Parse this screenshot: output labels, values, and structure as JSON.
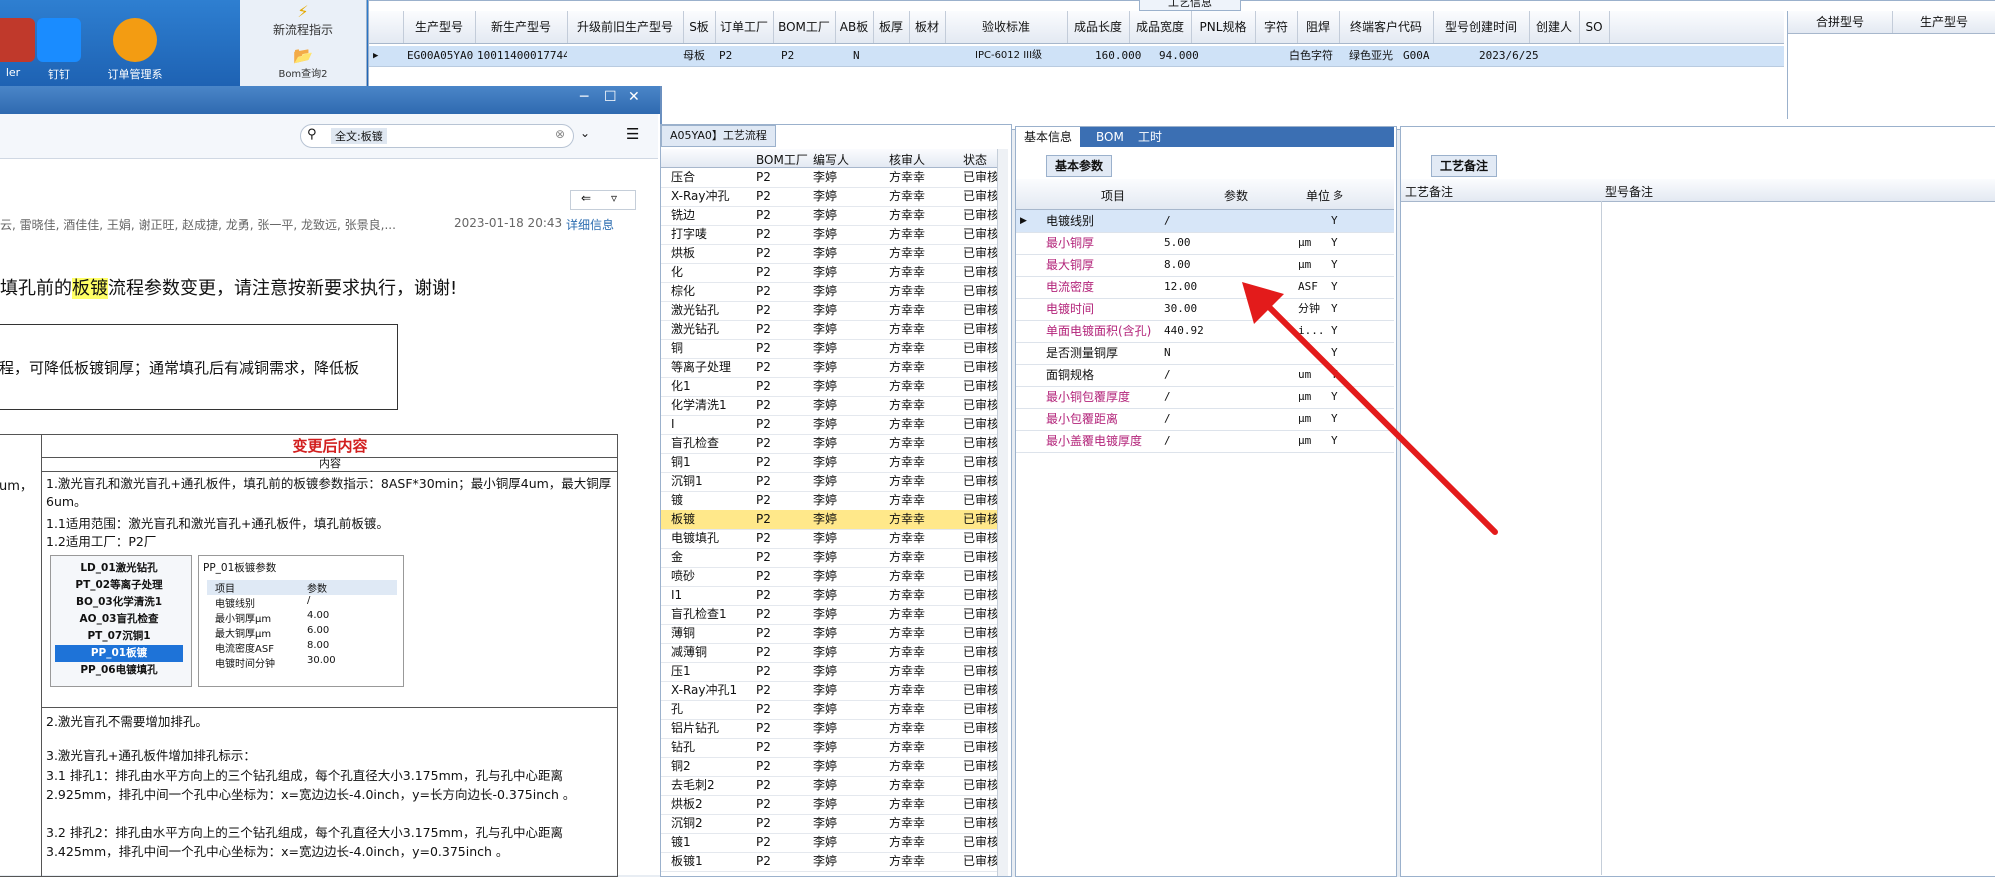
{
  "desktop": {
    "icons": [
      {
        "label": "ler",
        "color": "#c0392b"
      },
      {
        "label": "钉钉",
        "color": "#1a8cff"
      },
      {
        "label": "订单管理系",
        "color": "#f39c12"
      }
    ],
    "left_panel": {
      "item1": "新流程指示",
      "item2": "Bom查询2"
    }
  },
  "top_grid": {
    "headers": [
      "生产型号",
      "新生产型号",
      "升级前旧生产型号",
      "S板",
      "订单工厂",
      "BOM工厂",
      "AB板",
      "板厚",
      "板材",
      "验收标准",
      "成品长度",
      "成品宽度",
      "PNL规格",
      "字符",
      "阻焊",
      "终端客户代码",
      "型号创建时间",
      "创建人",
      "SO"
    ],
    "row": [
      "EG00A05YA0",
      "10011400017744",
      "",
      "母板",
      "P2",
      "P2",
      "N",
      "",
      "",
      "IPC-6012 III级",
      "160.000",
      "94.000",
      "",
      "白色字符",
      "绿色亚光",
      "G00A",
      "2023/6/25",
      "",
      ""
    ],
    "side_headers": [
      "合拼型号",
      "生产型号"
    ],
    "banner": "工艺信息"
  },
  "mail": {
    "search_text": "全文:板镀",
    "recipients": "云, 雷晓佳, 酒佳佳, 王娟, 谢正旺, 赵成捷, 龙勇, 张一平, 龙致远, 张景良,...",
    "date": "2023-01-18 20:43",
    "detail_link": "详细信息",
    "headline_before": "填孔前的",
    "headline_highlight": "板镀",
    "headline_after": "流程参数变更，请注意按新要求执行，谢谢!",
    "box_text": "程，可降低板镀铜厚；通常填孔后有减铜需求，降低板",
    "change_header": "变更后内容",
    "content_label": "内容",
    "left_fragment": "um，",
    "para1": "1.激光盲孔和激光盲孔+通孔板件，填孔前的板镀参数指示：8ASF*30min；最小铜厚4um，最大铜厚6um。",
    "para1_1": "1.1适用范围：激光盲孔和激光盲孔+通孔板件，填孔前板镀。",
    "para1_2": "1.2适用工厂：P2厂",
    "mini_list": [
      "LD_01激光钻孔",
      "PT_02等离子处理",
      "BO_03化学清洗1",
      "AO_03盲孔检查",
      "PT_07沉铜1",
      "PP_01板镀",
      "PP_06电镀填孔"
    ],
    "mini_title": "PP_01板镀参数",
    "mini_headers": [
      "项目",
      "参数"
    ],
    "mini_rows": [
      [
        "电镀线别",
        "/"
      ],
      [
        "最小铜厚μm",
        "4.00"
      ],
      [
        "最大铜厚μm",
        "6.00"
      ],
      [
        "电流密度ASF",
        "8.00"
      ],
      [
        "电镀时间分钟",
        "30.00"
      ]
    ],
    "para2": "2.激光盲孔不需要增加排孔。",
    "para3": "3.激光盲孔+通孔板件增加排孔标示：",
    "para3_1a": "3.1 排孔1：排孔由水平方向上的三个钻孔组成，每个孔直径大小3.175mm，孔与孔中心距离",
    "para3_1b": "2.925mm，排孔中间一个孔中心坐标为：x=宽边边长-4.0inch，y=长方向边长-0.375inch 。",
    "para3_2a": "3.2 排孔2：排孔由水平方向上的三个钻孔组成，每个孔直径大小3.175mm，孔与孔中心距离",
    "para3_2b": "3.425mm，排孔中间一个孔中心坐标为：x=宽边边长-4.0inch，y=0.375inch 。"
  },
  "process": {
    "tab": "A05YA0】工艺流程",
    "headers": [
      "",
      "BOM工厂",
      "编写人",
      "核审人",
      "状态"
    ],
    "rows": [
      [
        "压合",
        "P2",
        "李婷",
        "方幸幸",
        "已审核"
      ],
      [
        "X-Ray冲孔",
        "P2",
        "李婷",
        "方幸幸",
        "已审核"
      ],
      [
        "铣边",
        "P2",
        "李婷",
        "方幸幸",
        "已审核"
      ],
      [
        "打字唛",
        "P2",
        "李婷",
        "方幸幸",
        "已审核"
      ],
      [
        "烘板",
        "P2",
        "李婷",
        "方幸幸",
        "已审核"
      ],
      [
        "化",
        "P2",
        "李婷",
        "方幸幸",
        "已审核"
      ],
      [
        "棕化",
        "P2",
        "李婷",
        "方幸幸",
        "已审核"
      ],
      [
        "激光钻孔",
        "P2",
        "李婷",
        "方幸幸",
        "已审核"
      ],
      [
        "激光钻孔",
        "P2",
        "李婷",
        "方幸幸",
        "已审核"
      ],
      [
        "铜",
        "P2",
        "李婷",
        "方幸幸",
        "已审核"
      ],
      [
        "等离子处理",
        "P2",
        "李婷",
        "方幸幸",
        "已审核"
      ],
      [
        "化1",
        "P2",
        "李婷",
        "方幸幸",
        "已审核"
      ],
      [
        "化学清洗1",
        "P2",
        "李婷",
        "方幸幸",
        "已审核"
      ],
      [
        "I",
        "P2",
        "李婷",
        "方幸幸",
        "已审核"
      ],
      [
        "盲孔检查",
        "P2",
        "李婷",
        "方幸幸",
        "已审核"
      ],
      [
        "铜1",
        "P2",
        "李婷",
        "方幸幸",
        "已审核"
      ],
      [
        "沉铜1",
        "P2",
        "李婷",
        "方幸幸",
        "已审核"
      ],
      [
        "镀",
        "P2",
        "李婷",
        "方幸幸",
        "已审核"
      ],
      [
        "板镀",
        "P2",
        "李婷",
        "方幸幸",
        "已审核"
      ],
      [
        "电镀填孔",
        "P2",
        "李婷",
        "方幸幸",
        "已审核"
      ],
      [
        "金",
        "P2",
        "李婷",
        "方幸幸",
        "已审核"
      ],
      [
        "喷砂",
        "P2",
        "李婷",
        "方幸幸",
        "已审核"
      ],
      [
        "I1",
        "P2",
        "李婷",
        "方幸幸",
        "已审核"
      ],
      [
        "盲孔检查1",
        "P2",
        "李婷",
        "方幸幸",
        "已审核"
      ],
      [
        "薄铜",
        "P2",
        "李婷",
        "方幸幸",
        "已审核"
      ],
      [
        "减薄铜",
        "P2",
        "李婷",
        "方幸幸",
        "已审核"
      ],
      [
        "压1",
        "P2",
        "李婷",
        "方幸幸",
        "已审核"
      ],
      [
        "X-Ray冲孔1",
        "P2",
        "李婷",
        "方幸幸",
        "已审核"
      ],
      [
        "孔",
        "P2",
        "李婷",
        "方幸幸",
        "已审核"
      ],
      [
        "铝片钻孔",
        "P2",
        "李婷",
        "方幸幸",
        "已审核"
      ],
      [
        "钻孔",
        "P2",
        "李婷",
        "方幸幸",
        "已审核"
      ],
      [
        "铜2",
        "P2",
        "李婷",
        "方幸幸",
        "已审核"
      ],
      [
        "去毛刺2",
        "P2",
        "李婷",
        "方幸幸",
        "已审核"
      ],
      [
        "烘板2",
        "P2",
        "李婷",
        "方幸幸",
        "已审核"
      ],
      [
        "沉铜2",
        "P2",
        "李婷",
        "方幸幸",
        "已审核"
      ],
      [
        "镀1",
        "P2",
        "李婷",
        "方幸幸",
        "已审核"
      ],
      [
        "板镀1",
        "P2",
        "李婷",
        "方幸幸",
        "已审核"
      ]
    ]
  },
  "info": {
    "tabs": [
      "基本信息",
      "BOM",
      "工时"
    ],
    "subtab": "基本参数",
    "headers": [
      "项目",
      "参数",
      "单位",
      "多"
    ],
    "rows": [
      [
        "电镀线别",
        "/",
        "",
        "Y"
      ],
      [
        "最小铜厚",
        "5.00",
        "μm",
        "Y"
      ],
      [
        "最大铜厚",
        "8.00",
        "μm",
        "Y"
      ],
      [
        "电流密度",
        "12.00",
        "ASF",
        "Y"
      ],
      [
        "电镀时间",
        "30.00",
        "分钟",
        "Y"
      ],
      [
        "单面电镀面积(含孔)",
        "440.92",
        "i...",
        "Y"
      ],
      [
        "是否测量铜厚",
        "N",
        "",
        "Y"
      ],
      [
        "面铜规格",
        "/",
        "um",
        "Y"
      ],
      [
        "最小铜包覆厚度",
        "/",
        "μm",
        "Y"
      ],
      [
        "最小包覆距离",
        "/",
        "μm",
        "Y"
      ],
      [
        "最小盖覆电镀厚度",
        "/",
        "μm",
        "Y"
      ]
    ]
  },
  "remark": {
    "tab": "工艺备注",
    "headers": [
      "工艺备注",
      "型号备注"
    ]
  },
  "colors": {
    "arrow": "#e31b1b",
    "highlight": "#ffff66",
    "pink_label": "#b3247a",
    "selected_row": "#ffe88a"
  }
}
